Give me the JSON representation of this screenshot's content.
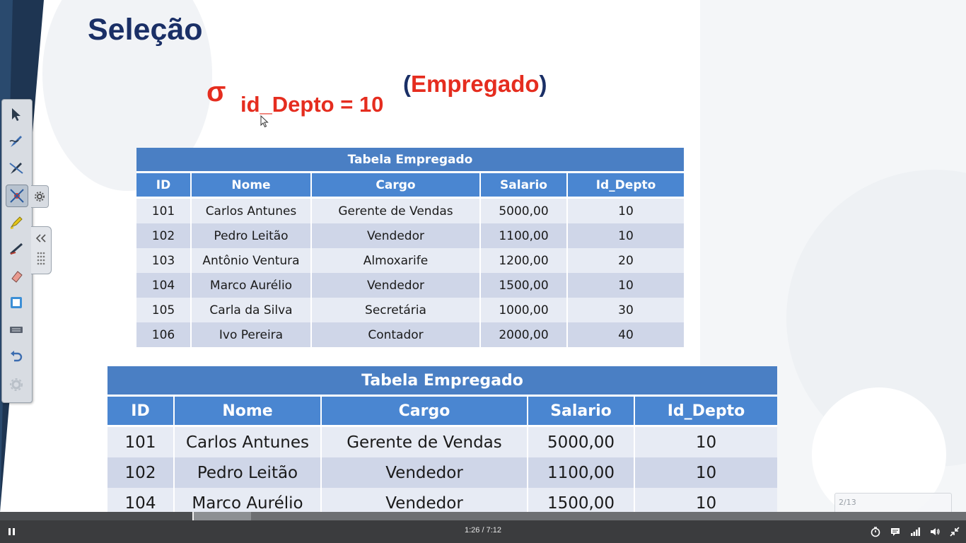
{
  "slide": {
    "title": "Seleção",
    "formula": {
      "sigma": "σ",
      "condition": "id_Depto = 10",
      "open_paren": "(",
      "relation": "Empregado",
      "close_paren": ")"
    },
    "source_table": {
      "caption": "Tabela Empregado",
      "headers": [
        "ID",
        "Nome",
        "Cargo",
        "Salario",
        "Id_Depto"
      ],
      "rows": [
        [
          "101",
          "Carlos Antunes",
          "Gerente de Vendas",
          "5000,00",
          "10"
        ],
        [
          "102",
          "Pedro Leitão",
          "Vendedor",
          "1100,00",
          "10"
        ],
        [
          "103",
          "Antônio Ventura",
          "Almoxarife",
          "1200,00",
          "20"
        ],
        [
          "104",
          "Marco Aurélio",
          "Vendedor",
          "1500,00",
          "10"
        ],
        [
          "105",
          "Carla da Silva",
          "Secretária",
          "1000,00",
          "30"
        ],
        [
          "106",
          "Ivo Pereira",
          "Contador",
          "2000,00",
          "40"
        ]
      ]
    },
    "result_table": {
      "caption": "Tabela Empregado",
      "headers": [
        "ID",
        "Nome",
        "Cargo",
        "Salario",
        "Id_Depto"
      ],
      "rows": [
        [
          "101",
          "Carlos Antunes",
          "Gerente de Vendas",
          "5000,00",
          "10"
        ],
        [
          "102",
          "Pedro Leitão",
          "Vendedor",
          "1100,00",
          "10"
        ],
        [
          "104",
          "Marco Aurélio",
          "Vendedor",
          "1500,00",
          "10"
        ]
      ]
    },
    "page_indicator": "2/13"
  },
  "annotation_toolbar": {
    "tools": [
      "pointer-icon",
      "pen-icon",
      "highlighter-pen-icon",
      "laser-pointer-icon",
      "marker-icon",
      "line-icon",
      "eraser-icon",
      "whiteboard-icon",
      "keyboard-icon",
      "undo-icon",
      "settings-icon"
    ],
    "active_tool": "laser-pointer-icon"
  },
  "player": {
    "time_display": "1:26 / 7:12",
    "progress_fraction": 0.2,
    "buffered_fraction": 0.26,
    "buttons": [
      "pause-icon",
      "timer-icon",
      "captions-icon",
      "quality-icon",
      "volume-icon",
      "exit-fullscreen-icon"
    ]
  },
  "colors": {
    "title": "#1a2f66",
    "formula_red": "#e52d1f",
    "header_blue": "#4a86d1",
    "row_light": "#e7ebf4",
    "row_dark": "#cfd6e8",
    "player_bar": "#3b3c3e"
  }
}
